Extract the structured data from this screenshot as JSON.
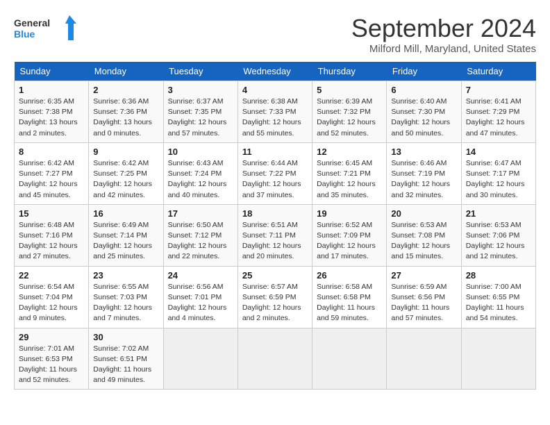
{
  "header": {
    "logo_general": "General",
    "logo_blue": "Blue",
    "month": "September 2024",
    "location": "Milford Mill, Maryland, United States"
  },
  "days_of_week": [
    "Sunday",
    "Monday",
    "Tuesday",
    "Wednesday",
    "Thursday",
    "Friday",
    "Saturday"
  ],
  "weeks": [
    [
      {
        "day": "1",
        "info": "Sunrise: 6:35 AM\nSunset: 7:38 PM\nDaylight: 13 hours\nand 2 minutes."
      },
      {
        "day": "2",
        "info": "Sunrise: 6:36 AM\nSunset: 7:36 PM\nDaylight: 13 hours\nand 0 minutes."
      },
      {
        "day": "3",
        "info": "Sunrise: 6:37 AM\nSunset: 7:35 PM\nDaylight: 12 hours\nand 57 minutes."
      },
      {
        "day": "4",
        "info": "Sunrise: 6:38 AM\nSunset: 7:33 PM\nDaylight: 12 hours\nand 55 minutes."
      },
      {
        "day": "5",
        "info": "Sunrise: 6:39 AM\nSunset: 7:32 PM\nDaylight: 12 hours\nand 52 minutes."
      },
      {
        "day": "6",
        "info": "Sunrise: 6:40 AM\nSunset: 7:30 PM\nDaylight: 12 hours\nand 50 minutes."
      },
      {
        "day": "7",
        "info": "Sunrise: 6:41 AM\nSunset: 7:29 PM\nDaylight: 12 hours\nand 47 minutes."
      }
    ],
    [
      {
        "day": "8",
        "info": "Sunrise: 6:42 AM\nSunset: 7:27 PM\nDaylight: 12 hours\nand 45 minutes."
      },
      {
        "day": "9",
        "info": "Sunrise: 6:42 AM\nSunset: 7:25 PM\nDaylight: 12 hours\nand 42 minutes."
      },
      {
        "day": "10",
        "info": "Sunrise: 6:43 AM\nSunset: 7:24 PM\nDaylight: 12 hours\nand 40 minutes."
      },
      {
        "day": "11",
        "info": "Sunrise: 6:44 AM\nSunset: 7:22 PM\nDaylight: 12 hours\nand 37 minutes."
      },
      {
        "day": "12",
        "info": "Sunrise: 6:45 AM\nSunset: 7:21 PM\nDaylight: 12 hours\nand 35 minutes."
      },
      {
        "day": "13",
        "info": "Sunrise: 6:46 AM\nSunset: 7:19 PM\nDaylight: 12 hours\nand 32 minutes."
      },
      {
        "day": "14",
        "info": "Sunrise: 6:47 AM\nSunset: 7:17 PM\nDaylight: 12 hours\nand 30 minutes."
      }
    ],
    [
      {
        "day": "15",
        "info": "Sunrise: 6:48 AM\nSunset: 7:16 PM\nDaylight: 12 hours\nand 27 minutes."
      },
      {
        "day": "16",
        "info": "Sunrise: 6:49 AM\nSunset: 7:14 PM\nDaylight: 12 hours\nand 25 minutes."
      },
      {
        "day": "17",
        "info": "Sunrise: 6:50 AM\nSunset: 7:12 PM\nDaylight: 12 hours\nand 22 minutes."
      },
      {
        "day": "18",
        "info": "Sunrise: 6:51 AM\nSunset: 7:11 PM\nDaylight: 12 hours\nand 20 minutes."
      },
      {
        "day": "19",
        "info": "Sunrise: 6:52 AM\nSunset: 7:09 PM\nDaylight: 12 hours\nand 17 minutes."
      },
      {
        "day": "20",
        "info": "Sunrise: 6:53 AM\nSunset: 7:08 PM\nDaylight: 12 hours\nand 15 minutes."
      },
      {
        "day": "21",
        "info": "Sunrise: 6:53 AM\nSunset: 7:06 PM\nDaylight: 12 hours\nand 12 minutes."
      }
    ],
    [
      {
        "day": "22",
        "info": "Sunrise: 6:54 AM\nSunset: 7:04 PM\nDaylight: 12 hours\nand 9 minutes."
      },
      {
        "day": "23",
        "info": "Sunrise: 6:55 AM\nSunset: 7:03 PM\nDaylight: 12 hours\nand 7 minutes."
      },
      {
        "day": "24",
        "info": "Sunrise: 6:56 AM\nSunset: 7:01 PM\nDaylight: 12 hours\nand 4 minutes."
      },
      {
        "day": "25",
        "info": "Sunrise: 6:57 AM\nSunset: 6:59 PM\nDaylight: 12 hours\nand 2 minutes."
      },
      {
        "day": "26",
        "info": "Sunrise: 6:58 AM\nSunset: 6:58 PM\nDaylight: 11 hours\nand 59 minutes."
      },
      {
        "day": "27",
        "info": "Sunrise: 6:59 AM\nSunset: 6:56 PM\nDaylight: 11 hours\nand 57 minutes."
      },
      {
        "day": "28",
        "info": "Sunrise: 7:00 AM\nSunset: 6:55 PM\nDaylight: 11 hours\nand 54 minutes."
      }
    ],
    [
      {
        "day": "29",
        "info": "Sunrise: 7:01 AM\nSunset: 6:53 PM\nDaylight: 11 hours\nand 52 minutes."
      },
      {
        "day": "30",
        "info": "Sunrise: 7:02 AM\nSunset: 6:51 PM\nDaylight: 11 hours\nand 49 minutes."
      },
      {
        "day": "",
        "info": ""
      },
      {
        "day": "",
        "info": ""
      },
      {
        "day": "",
        "info": ""
      },
      {
        "day": "",
        "info": ""
      },
      {
        "day": "",
        "info": ""
      }
    ]
  ]
}
